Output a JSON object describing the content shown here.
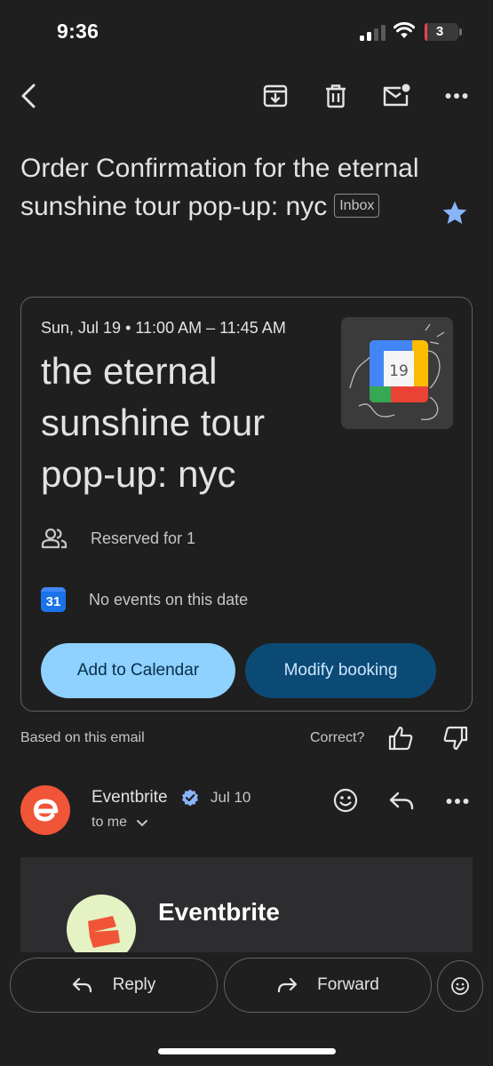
{
  "status_bar": {
    "time": "9:36",
    "battery_level": "3",
    "battery_fraction": 0.03,
    "battery_color": "#e5484d"
  },
  "toolbar": {
    "icons": [
      "back-arrow-icon",
      "archive-icon",
      "trash-icon",
      "mark-unread-icon",
      "more-icon"
    ]
  },
  "email": {
    "subject": "Order Confirmation for the eternal sunshine tour pop-up: nyc",
    "label_chip": "Inbox",
    "starred": true,
    "star_color": "#8ab4f8"
  },
  "event_card": {
    "date_time": "Sun, Jul 19 • 11:00 AM – 11:45 AM",
    "title": "the eternal sunshine tour pop-up: nyc",
    "thumbnail_day": "19",
    "reserved": "Reserved for 1",
    "calendar_badge": "31",
    "calendar_status": "No events on this date",
    "primary_button": "Add to Calendar",
    "secondary_button": "Modify booking",
    "primary_color": "#8fd1ff",
    "secondary_color": "#0b4a75"
  },
  "feedback": {
    "based_on": "Based on this email",
    "question": "Correct?"
  },
  "sender": {
    "name": "Eventbrite",
    "date": "Jul 10",
    "recipient": "to me",
    "brand_color": "#f05537"
  },
  "body_preview": {
    "brand_name": "Eventbrite"
  },
  "actions": {
    "reply": "Reply",
    "forward": "Forward"
  }
}
